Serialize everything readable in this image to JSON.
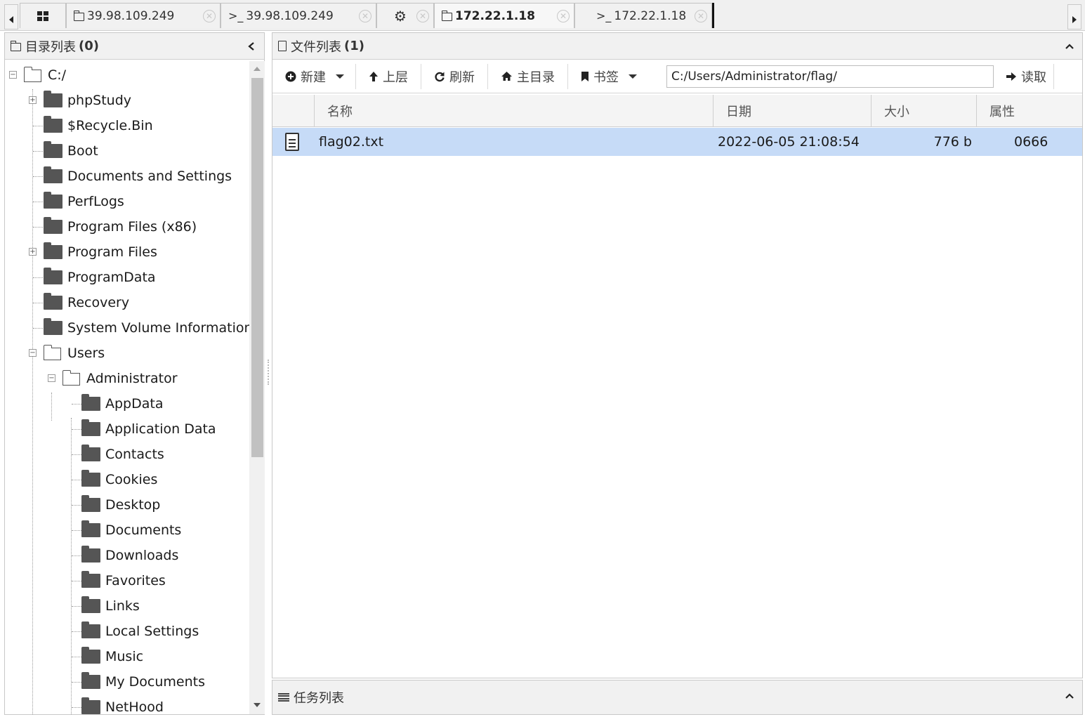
{
  "tabs": [
    {
      "label": "",
      "icon": "grid-icon"
    },
    {
      "label": "39.98.109.249",
      "icon": "folder-icon"
    },
    {
      "label": "39.98.109.249",
      "icon": "terminal-icon",
      "prefix": ">_"
    },
    {
      "label": "",
      "icon": "gear-icon"
    },
    {
      "label": "172.22.1.18",
      "icon": "folder-icon",
      "active": true
    },
    {
      "label": "172.22.1.18",
      "icon": "terminal-icon",
      "prefix": ">_"
    }
  ],
  "left_panel": {
    "title": "目录列表",
    "count": "(0)"
  },
  "tree": [
    {
      "label": "C:/",
      "open": true
    },
    {
      "label": "phpStudy"
    },
    {
      "label": "$Recycle.Bin"
    },
    {
      "label": "Boot"
    },
    {
      "label": "Documents and Settings"
    },
    {
      "label": "PerfLogs"
    },
    {
      "label": "Program Files (x86)"
    },
    {
      "label": "Program Files"
    },
    {
      "label": "ProgramData"
    },
    {
      "label": "Recovery"
    },
    {
      "label": "System Volume Information"
    },
    {
      "label": "Users",
      "open": true
    },
    {
      "label": "Administrator",
      "open": true
    },
    {
      "label": "AppData"
    },
    {
      "label": "Application Data"
    },
    {
      "label": "Contacts"
    },
    {
      "label": "Cookies"
    },
    {
      "label": "Desktop"
    },
    {
      "label": "Documents"
    },
    {
      "label": "Downloads"
    },
    {
      "label": "Favorites"
    },
    {
      "label": "Links"
    },
    {
      "label": "Local Settings"
    },
    {
      "label": "Music"
    },
    {
      "label": "My Documents"
    },
    {
      "label": "NetHood"
    }
  ],
  "right_panel": {
    "title": "文件列表",
    "count": "(1)"
  },
  "toolbar": {
    "new_label": "新建",
    "up_label": "上层",
    "refresh_label": "刷新",
    "home_label": "主目录",
    "bookmark_label": "书签",
    "path_value": "C:/Users/Administrator/flag/",
    "read_label": "读取"
  },
  "table": {
    "headers": [
      "名称",
      "日期",
      "大小",
      "属性"
    ],
    "rows": [
      {
        "name": "flag02.txt",
        "date": "2022-06-05 21:08:54",
        "size": "776 b",
        "attr": "0666"
      }
    ]
  },
  "bottom_panel": {
    "title": "任务列表"
  },
  "colors": {
    "selected_row": "#c6dbf7",
    "panel_header": "#f1f1f1"
  }
}
